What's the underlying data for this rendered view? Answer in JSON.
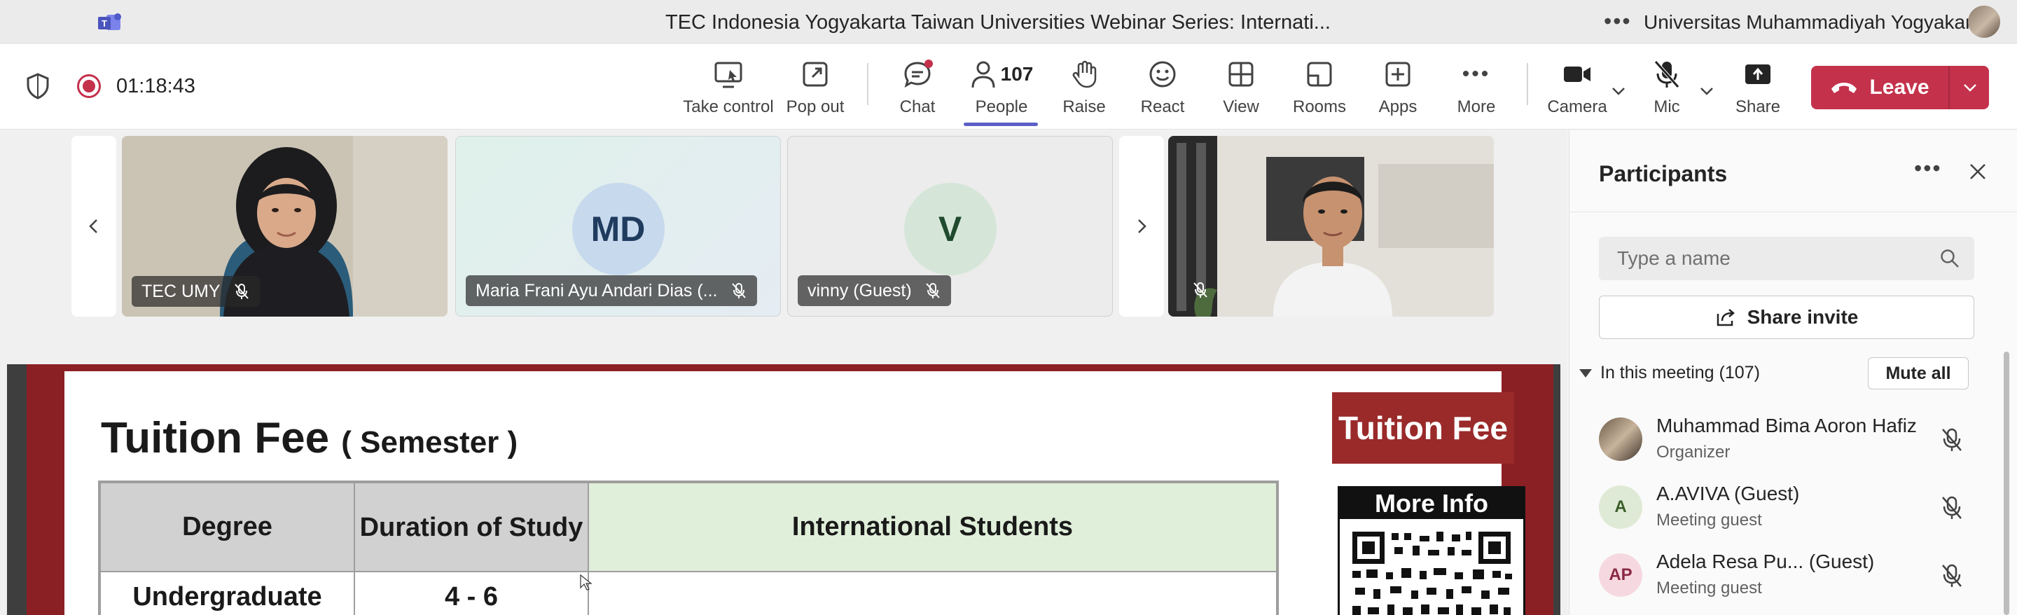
{
  "window": {
    "title": "TEC Indonesia Yogyakarta Taiwan Universities Webinar Series: Internati...",
    "organization": "Universitas Muhammadiyah Yogyakarta",
    "more_icon": "ellipsis-icon"
  },
  "toolbar": {
    "timer": "01:18:43",
    "buttons": {
      "take_control": "Take control",
      "pop_out": "Pop out",
      "chat": "Chat",
      "people": "People",
      "people_count": "107",
      "raise": "Raise",
      "react": "React",
      "view": "View",
      "rooms": "Rooms",
      "apps": "Apps",
      "more": "More",
      "camera": "Camera",
      "mic": "Mic",
      "share": "Share",
      "leave": "Leave"
    },
    "accent_color": "#5b5fc7",
    "leave_color": "#c4314b"
  },
  "gallery": {
    "tiles": [
      {
        "name": "TEC UMY",
        "muted": true
      },
      {
        "name": "Maria Frani Ayu Andari Dias (...",
        "initials": "MD",
        "muted": true
      },
      {
        "name": "vinny (Guest)",
        "initials": "V",
        "muted": true
      },
      {
        "name": "",
        "muted": true
      }
    ]
  },
  "slide": {
    "title": "Tuition Fee",
    "subtitle": "( Semester )",
    "table": {
      "headers": [
        "Degree",
        "Duration of Study",
        "International Students"
      ],
      "rows": [
        [
          "Undergraduate",
          "4 - 6",
          ""
        ]
      ]
    },
    "tag": "Tuition Fee",
    "more_info": "More Info"
  },
  "panel": {
    "title": "Participants",
    "search_placeholder": "Type a name",
    "share_invite": "Share invite",
    "section": "In this meeting (107)",
    "mute_all": "Mute all",
    "participants": [
      {
        "name": "Muhammad Bima Aoron Hafiz",
        "role": "Organizer",
        "initials": ""
      },
      {
        "name": "A.AVIVA (Guest)",
        "role": "Meeting guest",
        "initials": "A"
      },
      {
        "name": "Adela Resa Pu... (Guest)",
        "role": "Meeting guest",
        "initials": "AP"
      }
    ]
  }
}
